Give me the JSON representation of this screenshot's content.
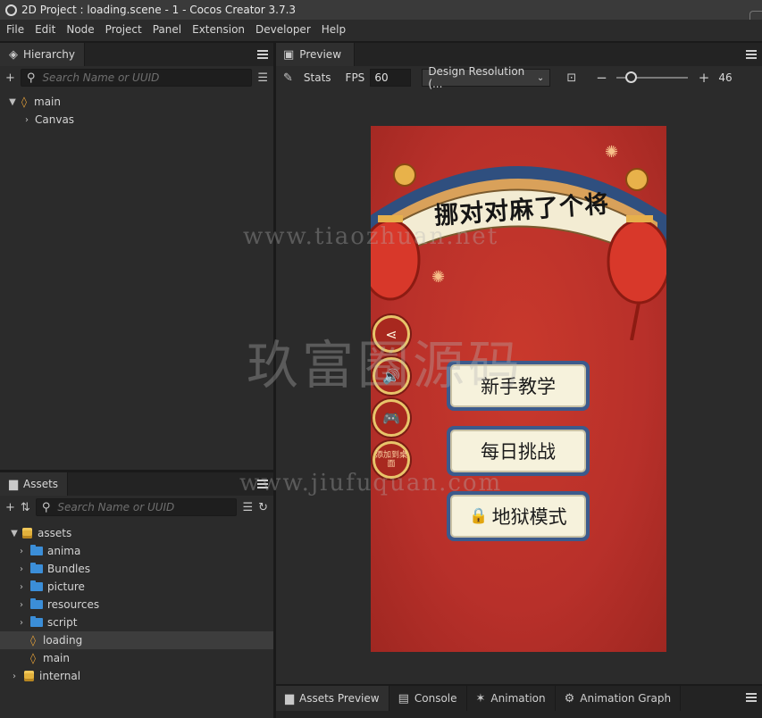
{
  "window": {
    "title": "2D Project : loading.scene - 1 - Cocos Creator 3.7.3"
  },
  "menu": [
    "File",
    "Edit",
    "Node",
    "Project",
    "Panel",
    "Extension",
    "Developer",
    "Help"
  ],
  "hierarchy": {
    "tab_label": "Hierarchy",
    "search_placeholder": "Search Name or UUID",
    "nodes": {
      "root": "main",
      "child": "Canvas"
    }
  },
  "assets": {
    "tab_label": "Assets",
    "search_placeholder": "Search Name or UUID",
    "root": "assets",
    "items": [
      "anima",
      "Bundles",
      "picture",
      "resources",
      "script",
      "loading",
      "main"
    ],
    "internal": "internal"
  },
  "preview": {
    "tab_label": "Preview",
    "stats_label": "Stats",
    "fps_label": "FPS",
    "fps_value": "60",
    "design_resolution": "Design Resolution (...",
    "zoom_value": "46"
  },
  "game": {
    "title_banner": "挪对对麻了个将",
    "buttons": {
      "tutorial": "新手教学",
      "daily": "每日挑战",
      "hell": "地狱模式"
    },
    "add_desktop": "添加到桌面"
  },
  "bottom_tabs": [
    "Assets Preview",
    "Console",
    "Animation",
    "Animation Graph"
  ],
  "watermarks": [
    "www.tiaozhuan.net",
    "玖富圈源码",
    "www.jiufuquan.com"
  ]
}
